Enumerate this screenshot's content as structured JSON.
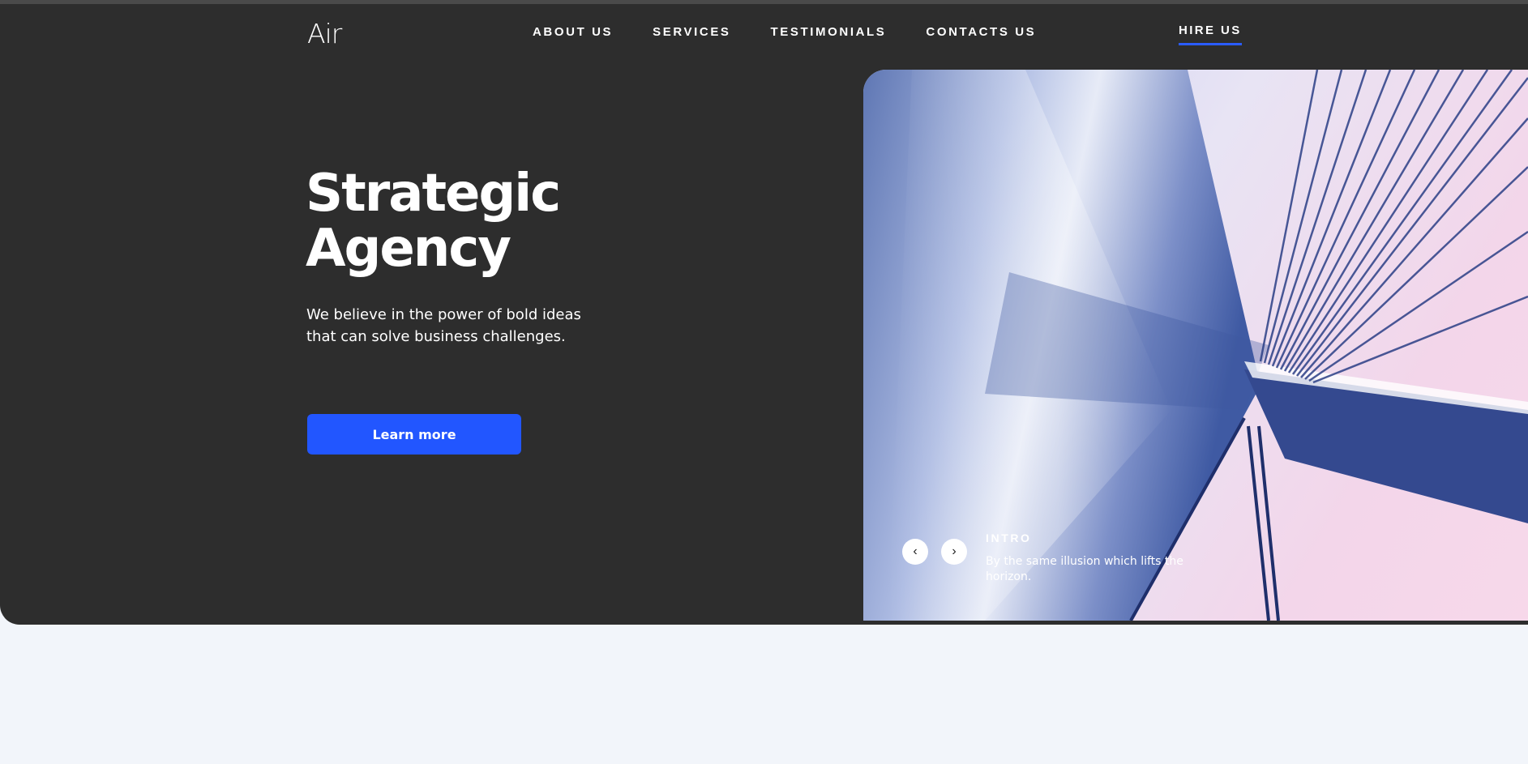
{
  "brand": {
    "name": "Air"
  },
  "nav": {
    "items": [
      {
        "label": "ABOUT US"
      },
      {
        "label": "SERVICES"
      },
      {
        "label": "TESTIMONIALS"
      },
      {
        "label": "CONTACTS US"
      }
    ],
    "cta_label": "HIRE US"
  },
  "hero": {
    "title": "Strategic Agency",
    "subtitle": "We believe in the power of bold ideas that can solve business challenges.",
    "button_label": "Learn more"
  },
  "slider": {
    "label": "INTRO",
    "caption": "By the same illusion which lifts the horizon.",
    "prev_icon": "chevron-left-icon",
    "next_icon": "chevron-right-icon"
  },
  "colors": {
    "hero_bg": "#2d2d2d",
    "page_bg": "#f2f5fa",
    "accent": "#2256ff"
  }
}
